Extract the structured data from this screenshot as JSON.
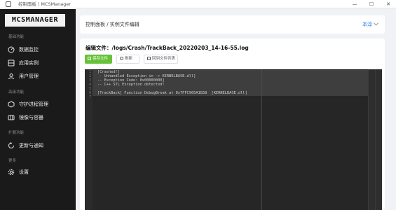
{
  "window": {
    "title": "控制面板 | MCSManager",
    "controls": [
      "—",
      "☐",
      "✕"
    ]
  },
  "sidebar": {
    "logo": "MCSMANAGER",
    "sections": [
      {
        "title": "基础功能"
      },
      {
        "title": "高级功能"
      },
      {
        "title": "扩展功能"
      },
      {
        "title": "更多"
      }
    ],
    "items": [
      {
        "label": "数据监控",
        "icon": "dashboard-icon"
      },
      {
        "label": "应用实例",
        "icon": "server-icon"
      },
      {
        "label": "用户管理",
        "icon": "users-icon"
      },
      {
        "label": "守护进程管理",
        "icon": "daemon-icon"
      },
      {
        "label": "镜像与容器",
        "icon": "container-icon"
      },
      {
        "label": "更新与通知",
        "icon": "update-icon"
      },
      {
        "label": "设置",
        "icon": "gear-icon"
      }
    ]
  },
  "header": {
    "breadcrumb": "控制面板 / 实例文件编辑",
    "user": "本淳"
  },
  "editor": {
    "file_label": "编辑文件：/logs/Crash/TrackBack_20220203_14-16-55.log",
    "buttons": {
      "save": "保存文件",
      "refresh": "刷新",
      "back": "回到文件列表"
    },
    "lines": [
      "[Crashed!]",
      " - Unhandled Exception in -> KERNELBASE.dll]",
      "-- Exception Code: 0x00000000]",
      "-- C++ STL Exception detected!",
      "",
      "[TrackBack] Function DebugBreak at 0x7FFC965A1B38  [KERNELBASE.dll]",
      ""
    ],
    "line_numbers": [
      "1",
      "2",
      "3",
      "4",
      "5",
      "6",
      "7"
    ]
  },
  "colors": {
    "sidebar_bg": "#1a1a1a",
    "save_button": "#67c23a",
    "editor_bg": "#262626",
    "accent": "#2a7cf0"
  }
}
